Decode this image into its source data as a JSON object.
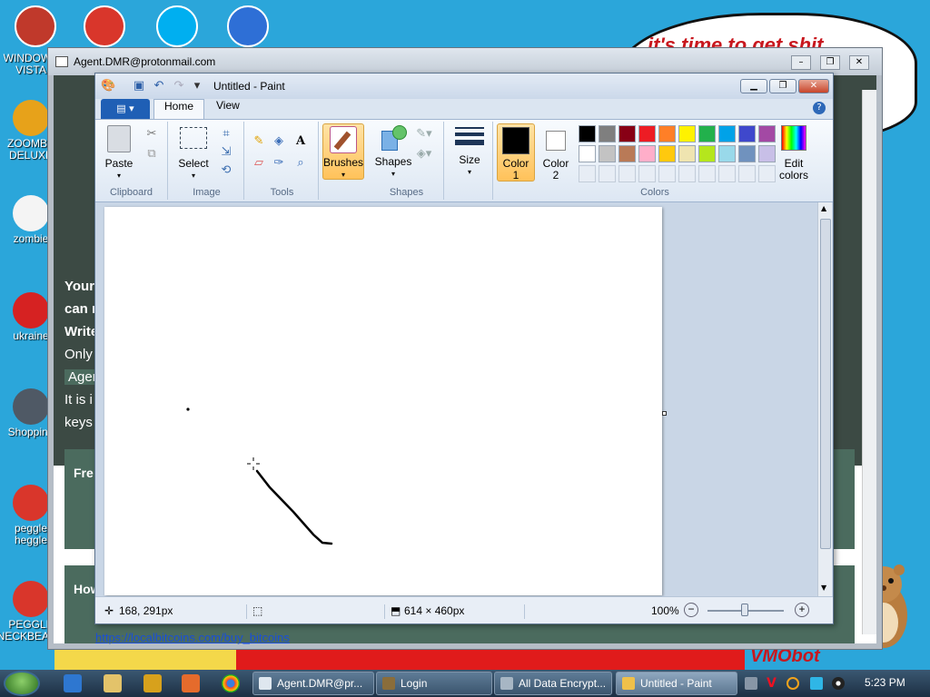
{
  "desktop": {
    "bubble_text": "it's time to get shit",
    "banner_text": "VMObot",
    "icons": [
      {
        "label": "WINDOWS\nVISTA",
        "color": "#c0392b"
      },
      {
        "label": "ZOOMBA\nDELUXE",
        "color": "#e7a21a"
      },
      {
        "label": "zombie",
        "color": "#f4f4f4"
      },
      {
        "label": "ukraine",
        "color": "#d62222"
      },
      {
        "label": "Shopping",
        "color": "#4f5965"
      },
      {
        "label": "peggle\nheggle",
        "color": "#d9362b"
      },
      {
        "label": "PEGGLE\nNECKBEARD",
        "color": "#d9362b"
      }
    ],
    "top_icons": [
      {
        "name": "red-bowl",
        "color": "#c0392b"
      },
      {
        "name": "peggle",
        "color": "#d9362b"
      },
      {
        "name": "skype",
        "color": "#00aff0"
      },
      {
        "name": "globe",
        "color": "#2e6fd6"
      }
    ]
  },
  "browser": {
    "title": "Agent.DMR@protonmail.com",
    "lines": [
      "Your",
      "can r",
      "Write",
      "Only",
      "Agen",
      "It is i",
      "keys"
    ],
    "green_blocks": [
      "Fre",
      "How"
    ],
    "link": "https://localbitcoins.com/buy_bitcoins"
  },
  "paint": {
    "title": "Untitled - Paint",
    "tabs": {
      "file": "▤ ▾",
      "home": "Home",
      "view": "View"
    },
    "groups": {
      "clipboard": "Clipboard",
      "image": "Image",
      "tools": "Tools",
      "shapes": "Shapes",
      "colors": "Colors"
    },
    "buttons": {
      "paste": "Paste",
      "select": "Select",
      "brushes": "Brushes",
      "shapes": "Shapes",
      "size": "Size",
      "color1": "Color\n1",
      "color2": "Color\n2",
      "edit_colors": "Edit\ncolors"
    },
    "palette_row1": [
      "#000000",
      "#7f7f7f",
      "#880015",
      "#ed1c24",
      "#ff7f27",
      "#fff200",
      "#22b14c",
      "#00a2e8",
      "#3f48cc",
      "#a349a4"
    ],
    "palette_row2": [
      "#ffffff",
      "#c3c3c3",
      "#b97a57",
      "#ffaec9",
      "#ffc90e",
      "#efe4b0",
      "#b5e61d",
      "#99d9ea",
      "#7092be",
      "#c8bfe7"
    ],
    "color1": "#000000",
    "color2": "#ffffff",
    "status": {
      "cursor_pos": "168, 291px",
      "canvas_size": "614 × 460px",
      "zoom": "100%"
    }
  },
  "taskbar": {
    "items": [
      {
        "label": "Agent.DMR@pr...",
        "icon_color": "#dfe7ef"
      },
      {
        "label": "Login",
        "icon_color": "#8a6d3b"
      },
      {
        "label": "All Data Encrypt...",
        "icon_color": "#a7b6c4"
      },
      {
        "label": "Untitled - Paint",
        "icon_color": "#f0c04a"
      }
    ],
    "clock": "5:23 PM"
  }
}
